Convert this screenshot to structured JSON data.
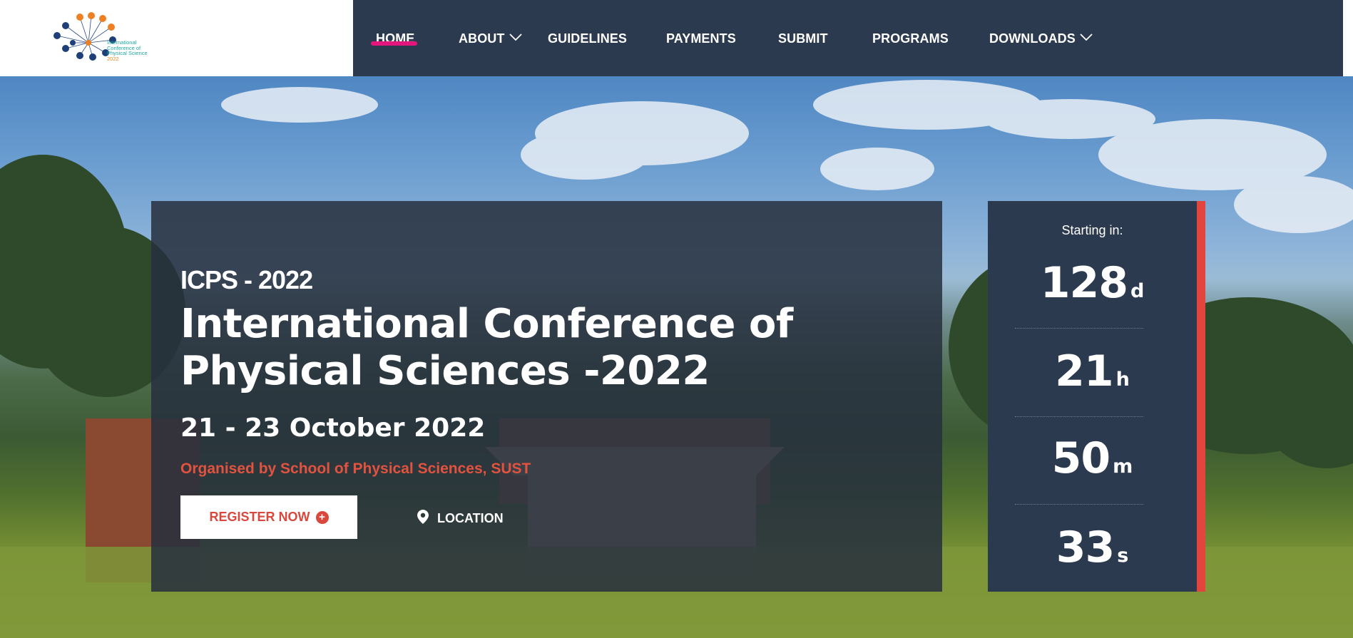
{
  "brand": {
    "logo_lines": [
      "International",
      "Conference of",
      "Physical Science",
      "2022"
    ],
    "colors": {
      "node_orange": "#ee7f22",
      "node_navy": "#1e3f78",
      "text_teal": "#1fa9a0"
    }
  },
  "nav": {
    "items": [
      {
        "label": "HOME",
        "active": true,
        "has_dropdown": false
      },
      {
        "label": "ABOUT",
        "active": false,
        "has_dropdown": true
      },
      {
        "label": "GUIDELINES",
        "active": false,
        "has_dropdown": false
      },
      {
        "label": "PAYMENTS",
        "active": false,
        "has_dropdown": false
      },
      {
        "label": "SUBMIT",
        "active": false,
        "has_dropdown": false
      },
      {
        "label": "PROGRAMS",
        "active": false,
        "has_dropdown": false
      },
      {
        "label": "DOWNLOADS",
        "active": false,
        "has_dropdown": true
      }
    ],
    "colors": {
      "background": "#2c3a4f",
      "active_underline": "#e4157d"
    }
  },
  "hero": {
    "subtitle": "ICPS - 2022",
    "title": "International Conference of Physical Sciences -2022",
    "dates": "21 - 23 October 2022",
    "organiser": "Organised by School of Physical Sciences, SUST",
    "register_label": "REGISTER NOW",
    "location_label": "LOCATION",
    "colors": {
      "accent_red": "#e2533f",
      "panel": "#26303e"
    }
  },
  "countdown": {
    "label": "Starting in:",
    "days": "128",
    "days_unit": "d",
    "hours": "21",
    "hours_unit": "h",
    "minutes": "50",
    "minutes_unit": "m",
    "seconds": "33",
    "seconds_unit": "s",
    "colors": {
      "panel": "#2c3a4f",
      "accent": "#e2453d"
    }
  }
}
